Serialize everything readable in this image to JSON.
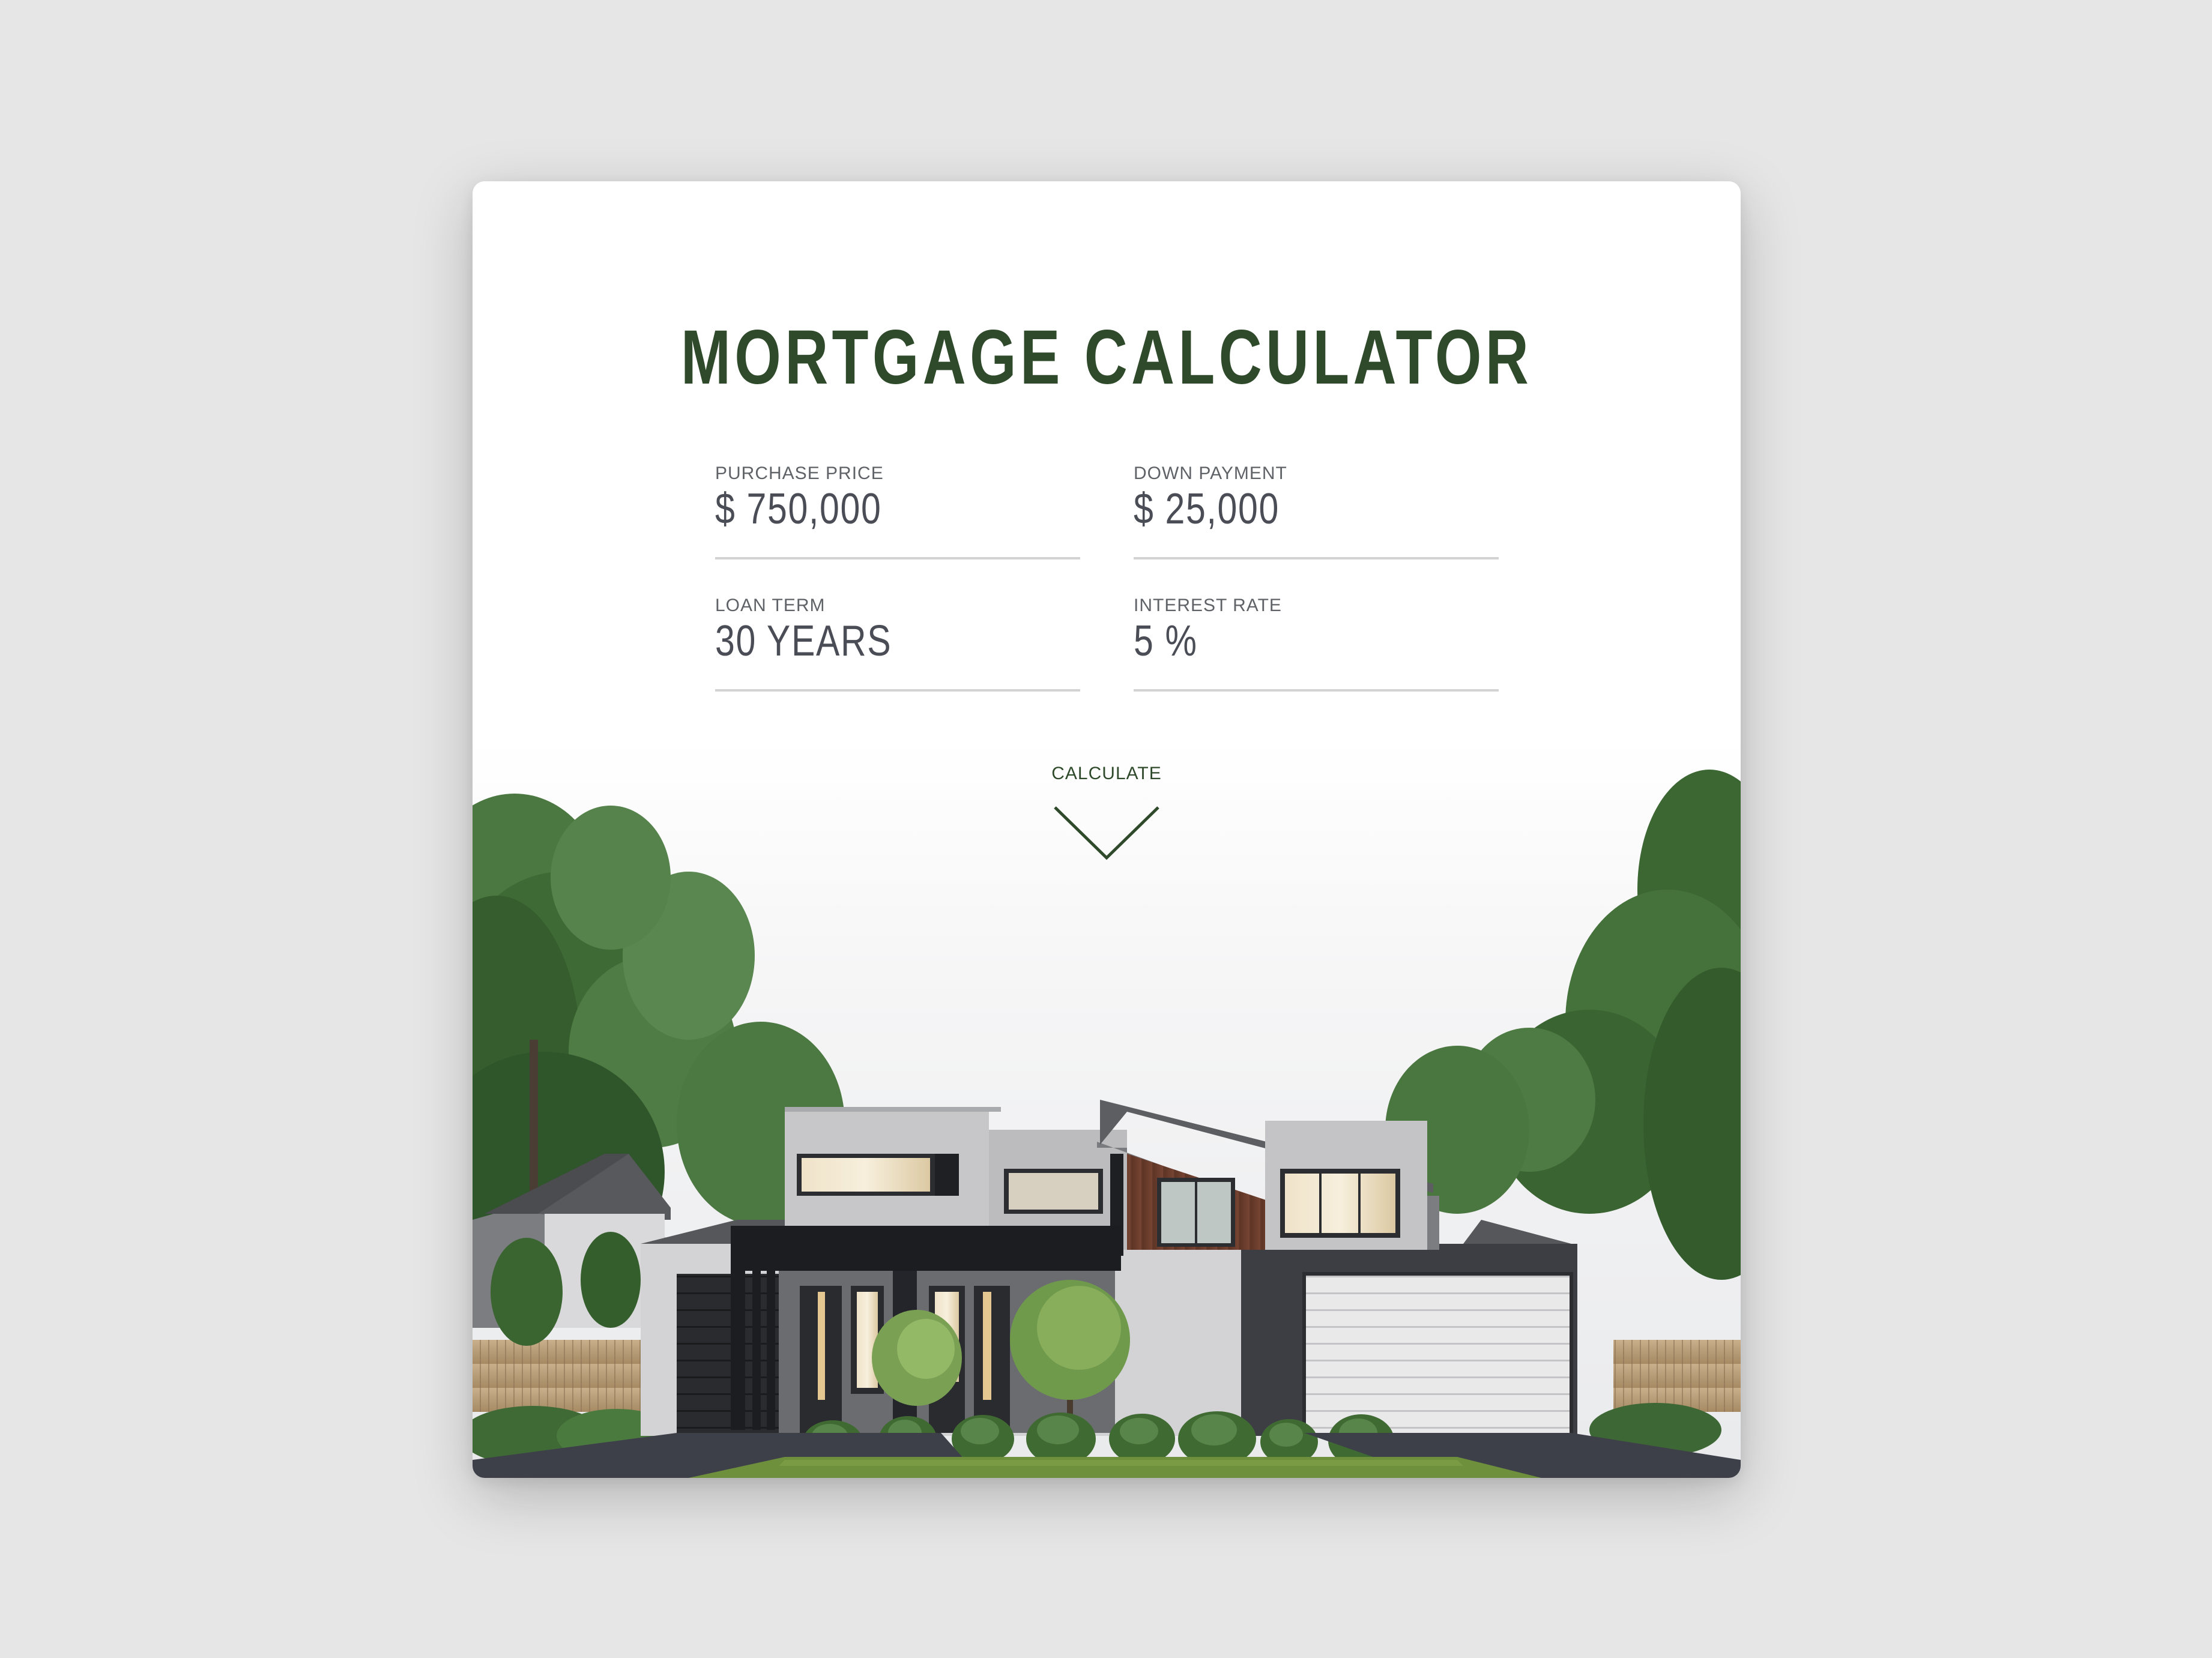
{
  "calculator": {
    "title": "MORTGAGE CALCULATOR",
    "fields": {
      "purchase_price": {
        "label": "PURCHASE PRICE",
        "value": "$ 750,000"
      },
      "down_payment": {
        "label": "DOWN PAYMENT",
        "value": "$ 25,000"
      },
      "loan_term": {
        "label": "LOAN TERM",
        "value": "30 YEARS"
      },
      "interest_rate": {
        "label": "INTEREST RATE",
        "value": "5 %"
      }
    },
    "calculate_label": "CALCULATE"
  },
  "colors": {
    "page_background": "#e6e6e6",
    "card_background": "#ffffff",
    "accent_green": "#2f4a2b",
    "label_gray": "#5f6266",
    "value_gray": "#4a4d55",
    "divider": "#d3d3d3"
  },
  "icons": {
    "calculate": "chevron-down-icon"
  }
}
